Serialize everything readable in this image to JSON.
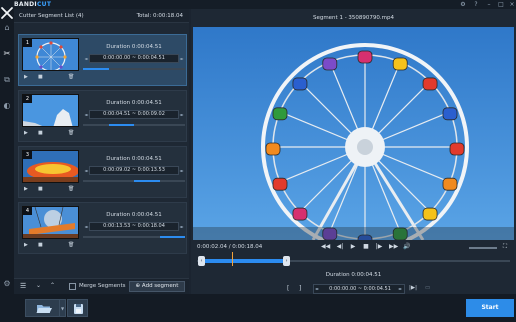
{
  "app": {
    "logo_main": "BANDI",
    "logo_accent": "CUT",
    "icons": [
      "close-icon",
      "scissors-icon",
      "join-icon",
      "settings-icon",
      "help-icon",
      "minimize-icon",
      "maximize-icon",
      "window-close-icon"
    ]
  },
  "colors": {
    "accent": "#2c8cf0",
    "selected_row": "#2d4a66",
    "start_button": "#2d8ce8",
    "playhead": "#f2a23a"
  },
  "segment_list": {
    "title": "Cutter Segment List (4)",
    "total": "Total: 0:00:18.04",
    "items": [
      {
        "number": "1",
        "duration": "Duration 0:00:04.51",
        "range": "0:00:00.00 ~ 0:00:04.51",
        "bar_start": 0.0,
        "bar_end": 0.25,
        "selected": true,
        "thumb": "ferris-wheel"
      },
      {
        "number": "2",
        "duration": "Duration 0:00:04.51",
        "range": "0:00:04.51 ~ 0:00:09.02",
        "bar_start": 0.25,
        "bar_end": 0.5,
        "selected": false,
        "thumb": "blue-sky"
      },
      {
        "number": "3",
        "duration": "Duration 0:00:04.51",
        "range": "0:00:09.02 ~ 0:00:13.53",
        "bar_start": 0.5,
        "bar_end": 0.75,
        "selected": false,
        "thumb": "spinning-ride"
      },
      {
        "number": "4",
        "duration": "Duration 0:00:04.51",
        "range": "0:00:13.53 ~ 0:00:18.04",
        "bar_start": 0.75,
        "bar_end": 1.0,
        "selected": false,
        "thumb": "swing-ride"
      }
    ],
    "footer": {
      "merge_label": "Merge Segments",
      "merge_checked": false,
      "add_segment_label": "Add segment"
    }
  },
  "preview": {
    "title": "Segment 1 - 350890790.mp4",
    "current_time": "0:00:02.04 / 0:00:18.04",
    "playhead_fraction": 0.113,
    "selection_fraction": [
      0.0,
      0.25
    ],
    "duration": "Duration 0:00:04.51",
    "range": "0:00:00.00 ~ 0:00:04.51",
    "prev_marker": "[",
    "next_marker": "]"
  },
  "bottom": {
    "start_label": "Start",
    "open_icon": "folder-open-icon",
    "save_icon": "save-icon"
  }
}
